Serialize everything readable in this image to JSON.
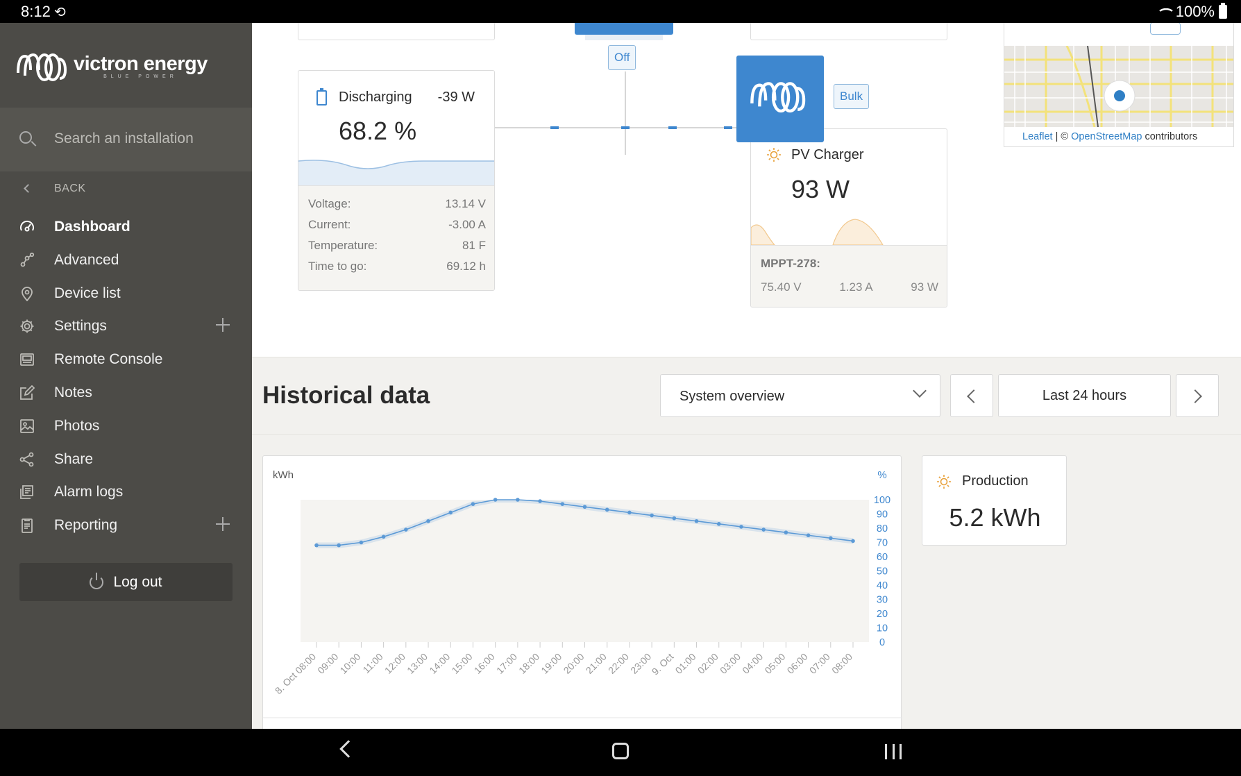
{
  "status_bar": {
    "time": "8:12",
    "battery": "100%"
  },
  "brand": {
    "name": "victron energy",
    "tagline": "BLUE POWER"
  },
  "sidebar": {
    "search_placeholder": "Search an installation",
    "back_label": "BACK",
    "items": [
      {
        "label": "Dashboard",
        "icon": "gauge-icon"
      },
      {
        "label": "Advanced",
        "icon": "graph-nodes-icon"
      },
      {
        "label": "Device list",
        "icon": "location-pin-icon"
      },
      {
        "label": "Settings",
        "icon": "gear-icon"
      },
      {
        "label": "Remote Console",
        "icon": "console-icon"
      },
      {
        "label": "Notes",
        "icon": "edit-icon"
      },
      {
        "label": "Photos",
        "icon": "image-icon"
      },
      {
        "label": "Share",
        "icon": "share-icon"
      },
      {
        "label": "Alarm logs",
        "icon": "alarm-log-icon"
      },
      {
        "label": "Reporting",
        "icon": "report-icon"
      }
    ],
    "logout_label": "Log out"
  },
  "overview": {
    "inverter_state": "Off",
    "charger_state": "Bulk",
    "battery": {
      "title": "Discharging",
      "power": "-39 W",
      "soc": "68.2 %",
      "details": [
        {
          "label": "Voltage:",
          "value": "13.14 V"
        },
        {
          "label": "Current:",
          "value": "-3.00 A"
        },
        {
          "label": "Temperature:",
          "value": "81 F"
        },
        {
          "label": "Time to go:",
          "value": "69.12 h"
        }
      ]
    },
    "pv": {
      "title": "PV Charger",
      "power": "93 W",
      "device": "MPPT-278:",
      "voltage": "75.40 V",
      "current": "1.23 A",
      "device_power": "93 W"
    },
    "map": {
      "attr_leaflet": "Leaflet",
      "attr_sep": " | © ",
      "attr_osm": "OpenStreetMap",
      "attr_tail": " contributors"
    }
  },
  "historical": {
    "title": "Historical data",
    "view_select": "System overview",
    "range": "Last 24 hours"
  },
  "production": {
    "title": "Production",
    "value": "5.2 kWh"
  },
  "colors": {
    "accent": "#3e87cf",
    "sidebar": "#4c4b47",
    "sun": "#e8a13a"
  },
  "chart_data": {
    "type": "line",
    "ylabel_left": "kWh",
    "ylabel_right": "%",
    "y_right_lim": [
      0,
      100
    ],
    "y_right_ticks": [
      100,
      90,
      80,
      70,
      60,
      50,
      40,
      30,
      20,
      10,
      0
    ],
    "x": [
      "8. Oct 08:00",
      "09:00",
      "10:00",
      "11:00",
      "12:00",
      "13:00",
      "14:00",
      "15:00",
      "16:00",
      "17:00",
      "18:00",
      "19:00",
      "20:00",
      "21:00",
      "22:00",
      "23:00",
      "9. Oct",
      "01:00",
      "02:00",
      "03:00",
      "04:00",
      "05:00",
      "06:00",
      "07:00",
      "08:00"
    ],
    "series": [
      {
        "name": "",
        "axis": "right",
        "values": [
          68,
          68,
          70,
          74,
          79,
          85,
          91,
          97,
          100,
          100,
          99,
          97,
          95,
          93,
          91,
          89,
          87,
          85,
          83,
          81,
          79,
          77,
          75,
          73,
          71
        ]
      }
    ]
  }
}
